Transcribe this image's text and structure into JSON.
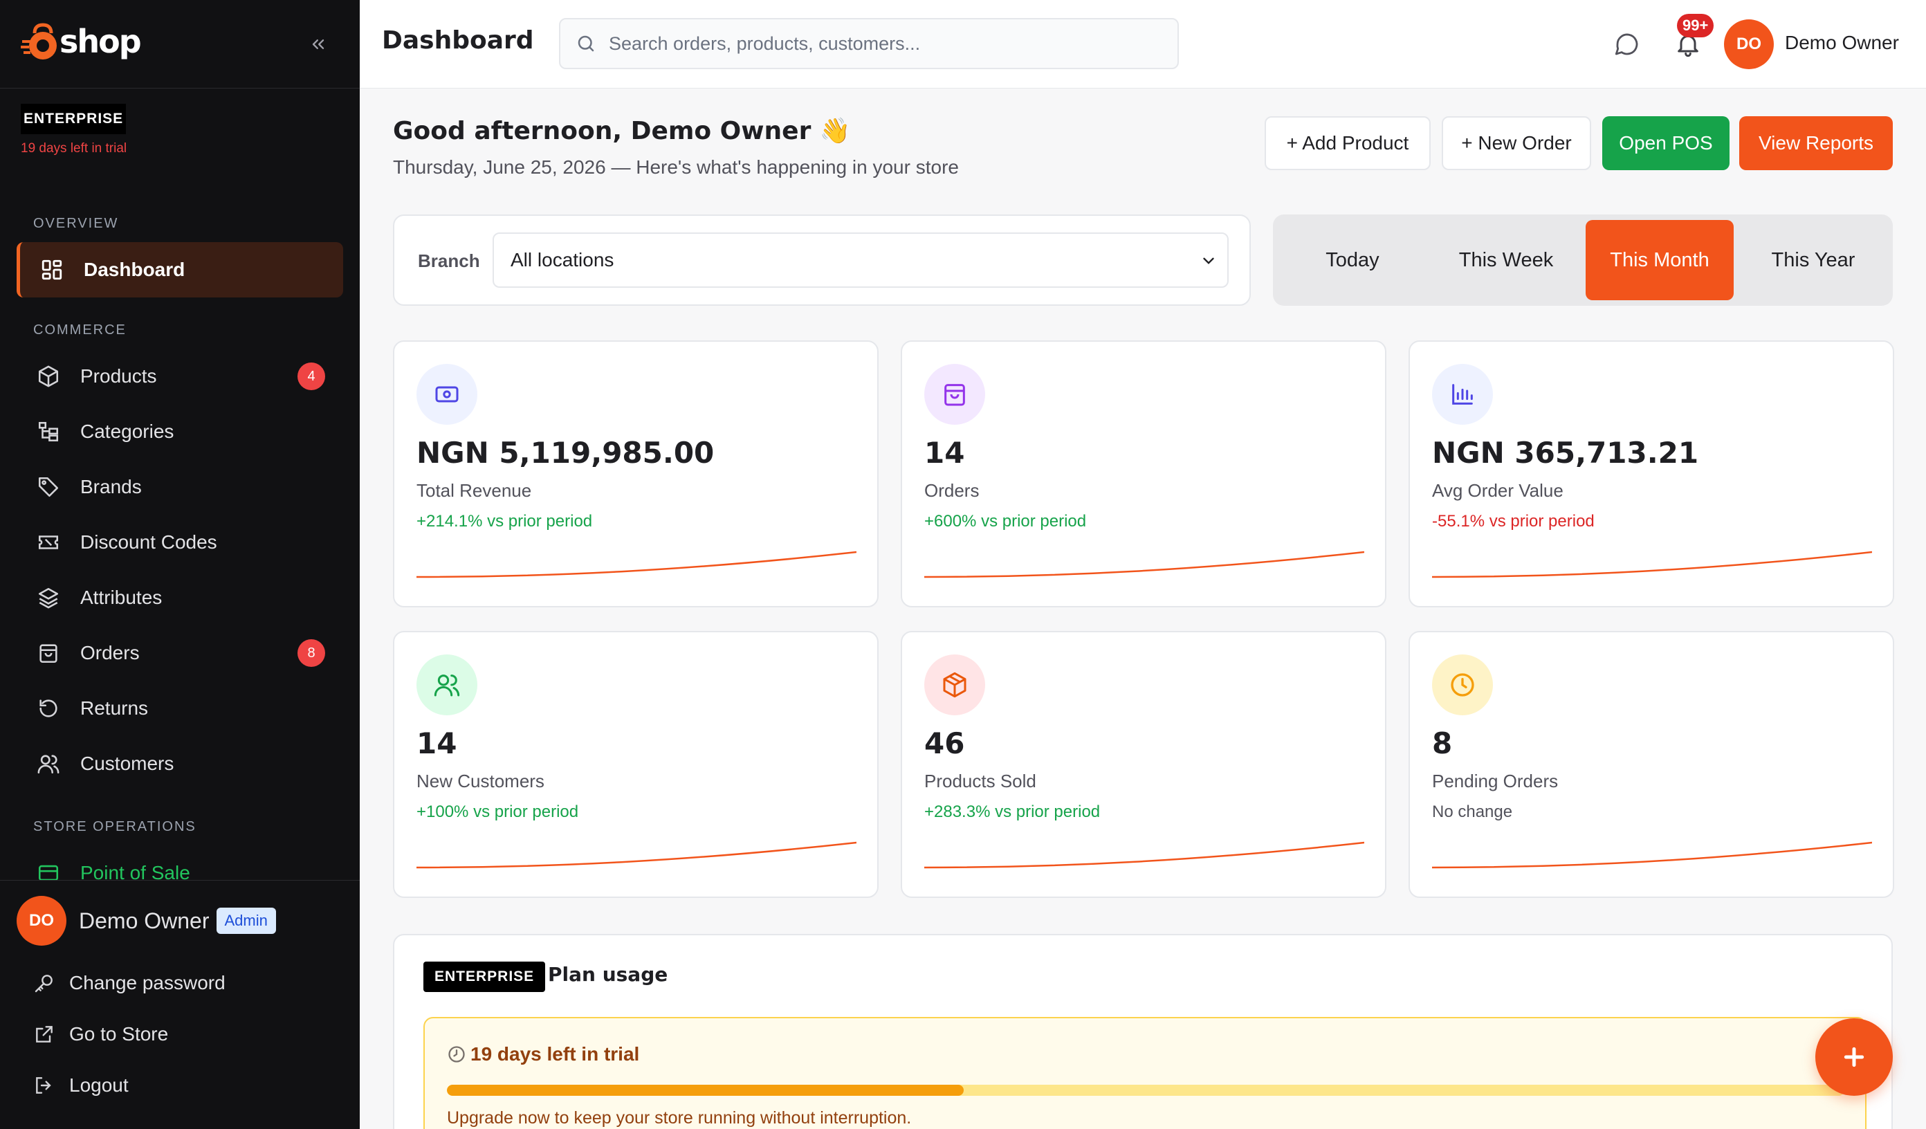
{
  "brand": {
    "name": "shop",
    "accent": "#f2541b"
  },
  "sidebar": {
    "plan": "ENTERPRISE",
    "trial_left": "19 days left in trial",
    "sections": {
      "overview": "OVERVIEW",
      "commerce": "COMMERCE",
      "store_ops": "STORE OPERATIONS"
    },
    "dashboard": {
      "label": "Dashboard",
      "icon": "grid-icon"
    },
    "commerce_items": [
      {
        "label": "Products",
        "icon": "cube-icon",
        "badge": "4"
      },
      {
        "label": "Categories",
        "icon": "tree-icon"
      },
      {
        "label": "Brands",
        "icon": "tag-icon"
      },
      {
        "label": "Discount Codes",
        "icon": "ticket-icon"
      },
      {
        "label": "Attributes",
        "icon": "layers-icon"
      },
      {
        "label": "Orders",
        "icon": "bag-icon",
        "badge": "8"
      },
      {
        "label": "Returns",
        "icon": "return-icon"
      },
      {
        "label": "Customers",
        "icon": "users-icon"
      }
    ],
    "pos": {
      "label": "Point of Sale",
      "icon": "register-icon"
    },
    "user": {
      "initials": "DO",
      "name": "Demo Owner",
      "role": "Admin"
    },
    "footer_links": [
      {
        "label": "Change password",
        "icon": "key-icon"
      },
      {
        "label": "Go to Store",
        "icon": "external-link-icon"
      },
      {
        "label": "Logout",
        "icon": "logout-icon"
      }
    ]
  },
  "topbar": {
    "title": "Dashboard",
    "search_placeholder": "Search orders, products, customers...",
    "notifications": "99+",
    "user": {
      "initials": "DO",
      "name": "Demo Owner"
    }
  },
  "main": {
    "greeting": "Good afternoon, Demo Owner 👋",
    "subtitle": "Thursday, June 25, 2026 — Here's what's happening in your store",
    "actions": {
      "add_product": "+ Add Product",
      "new_order": "+ New Order",
      "open_pos": "Open POS",
      "view_reports": "View Reports"
    },
    "filter": {
      "label": "Branch",
      "value": "All locations"
    },
    "periods": [
      "Today",
      "This Week",
      "This Month",
      "This Year"
    ],
    "active_period": "This Month",
    "stats": [
      {
        "value": "NGN 5,119,985.00",
        "label": "Total Revenue",
        "change": "+214.1% vs prior period",
        "trend": "up",
        "icon": "cash-icon"
      },
      {
        "value": "14",
        "label": "Orders",
        "change": "+600% vs prior period",
        "trend": "up",
        "icon": "bag-icon"
      },
      {
        "value": "NGN 365,713.21",
        "label": "Avg Order Value",
        "change": "-55.1% vs prior period",
        "trend": "down",
        "icon": "bar-chart-icon"
      },
      {
        "value": "14",
        "label": "New Customers",
        "change": "+100% vs prior period",
        "trend": "up",
        "icon": "users-icon"
      },
      {
        "value": "46",
        "label": "Products Sold",
        "change": "+283.3% vs prior period",
        "trend": "up",
        "icon": "package-icon"
      },
      {
        "value": "8",
        "label": "Pending Orders",
        "change": "No change",
        "trend": "flat",
        "icon": "clock-icon"
      }
    ],
    "plan_usage": {
      "chip": "ENTERPRISE",
      "title": "Plan usage",
      "trial_title": "19 days left in trial",
      "trial_progress": 0.37,
      "trial_message": "Upgrade now to keep your store running without interruption."
    }
  }
}
